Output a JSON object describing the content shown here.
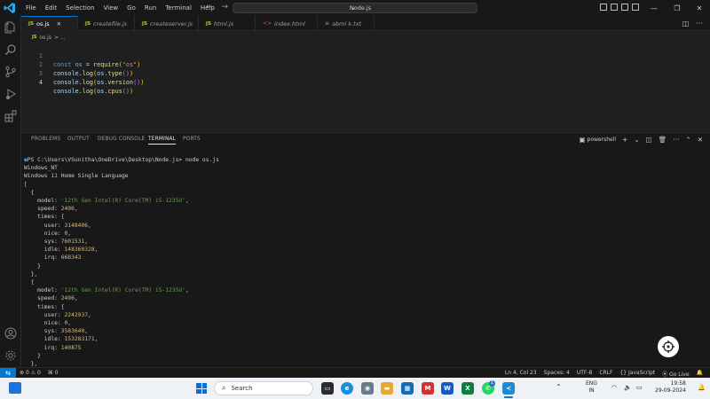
{
  "window": {
    "title": "Node.js"
  },
  "menu": [
    "File",
    "Edit",
    "Selection",
    "View",
    "Go",
    "Run",
    "Terminal",
    "Help"
  ],
  "tabs": [
    {
      "label": "os.js",
      "kind": "js",
      "active": true
    },
    {
      "label": "createfile.js",
      "kind": "js"
    },
    {
      "label": "createserver.js",
      "kind": "js"
    },
    {
      "label": "html.js",
      "kind": "js"
    },
    {
      "label": "index.html",
      "kind": "html"
    },
    {
      "label": "abmi k.txt",
      "kind": "txt"
    }
  ],
  "breadcrumb": {
    "file": "os.js",
    "sep": "> ..."
  },
  "editor": {
    "line_numbers": [
      "1",
      "2",
      "3",
      "4"
    ],
    "lines": [
      "const os = require(\"os\")",
      "console.log(os.type())",
      "console.log(os.version())",
      "console.log(os.cpus())"
    ]
  },
  "panel": {
    "tabs": [
      "PROBLEMS",
      "OUTPUT",
      "DEBUG CONSOLE",
      "TERMINAL",
      "PORTS"
    ],
    "active_tab": "TERMINAL",
    "shell": "powershell",
    "terminal_lines": [
      "PS C:\\Users\\VSunitha\\OneDrive\\Desktop\\Node.js> node os.js",
      "Windows_NT",
      "Windows 11 Home Single Language",
      "[",
      "  {",
      "    model: '12th Gen Intel(R) Core(TM) i5-1235U',",
      "    speed: 2496,",
      "    times: {",
      "      user: 3148406,",
      "      nice: 0,",
      "      sys: 7601531,",
      "      idle: 148360328,",
      "      irq: 668343",
      "    }",
      "  },",
      "  {",
      "    model: '12th Gen Intel(R) Core(TM) i5-1235U',",
      "    speed: 2496,",
      "    times: {",
      "      user: 2242937,",
      "      nice: 0,",
      "      sys: 3583640,",
      "      idle: 153283171,",
      "      irq: 140875",
      "    }",
      "  },"
    ]
  },
  "statusbar": {
    "errors": "0",
    "warnings": "0",
    "ports": "0",
    "position": "Ln 4, Col 23",
    "spaces": "Spaces: 4",
    "encoding": "UTF-8",
    "eol": "CRLF",
    "language": "JavaScript",
    "golive": "Go Live"
  },
  "taskbar": {
    "search_placeholder": "Search",
    "lang_top": "ENG",
    "lang_bottom": "IN",
    "time": "19:58",
    "date": "29-09-2024",
    "notif_badge": "1"
  },
  "colors": {
    "accent": "#0078d4",
    "editor_bg": "#1f1f1f",
    "chrome_bg": "#181818",
    "string": "#ce9178",
    "number": "#d7ba7d",
    "term_string": "#6a9955"
  }
}
